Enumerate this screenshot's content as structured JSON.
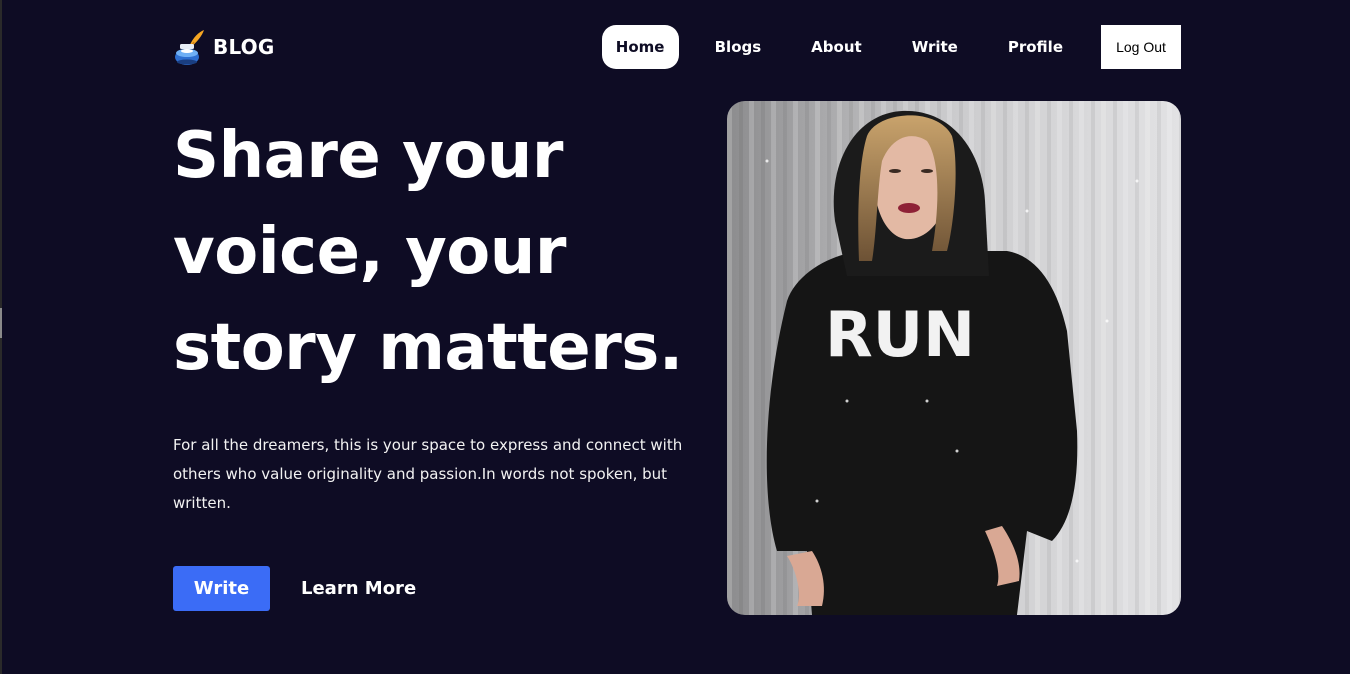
{
  "brand": {
    "name": "BLOG",
    "icon": "inkwell-quill-icon"
  },
  "nav": {
    "home": "Home",
    "blogs": "Blogs",
    "about": "About",
    "write": "Write",
    "profile": "Profile",
    "logout": "Log Out"
  },
  "hero": {
    "title_line1": "Share your",
    "title_line2": "voice, your",
    "title_line3": "story matters.",
    "description": "For all the dreamers, this is your space to express and connect with others who value originality and passion.In words not spoken, but written.",
    "write_button": "Write",
    "learn_more": "Learn More",
    "photo": {
      "hoodie_text": "RUN"
    }
  },
  "colors": {
    "background": "#0e0c24",
    "accent": "#3b6cf6",
    "text": "#ffffff"
  }
}
